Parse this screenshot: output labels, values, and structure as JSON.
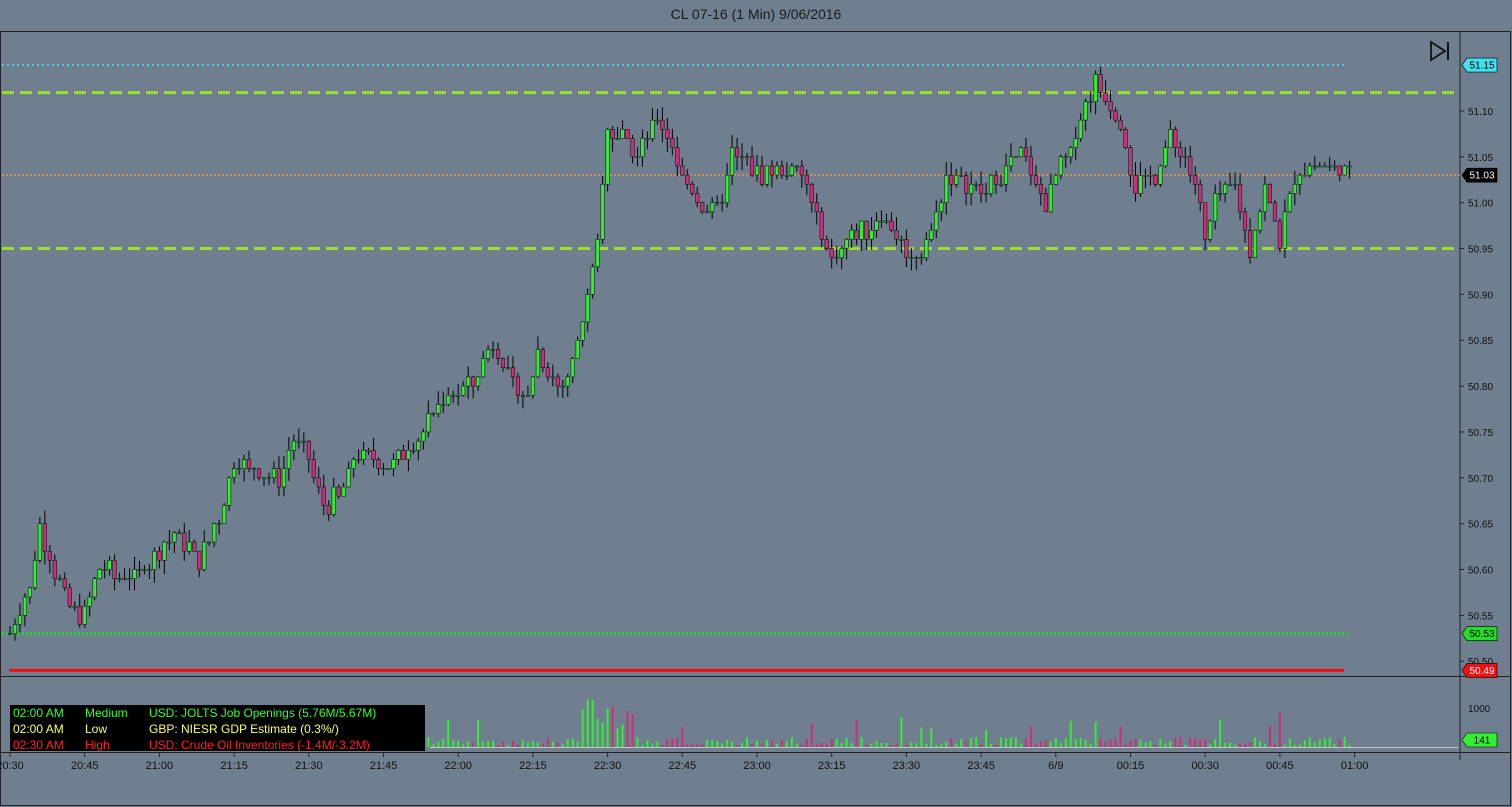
{
  "window": {
    "title": "CL 07-16 (1 Min)  9/06/2016"
  },
  "controls": {
    "play_icon": "skip-forward-icon"
  },
  "colors": {
    "background": "#6f7f90",
    "up_candle": "#33ee33",
    "down_candle": "#cc2f7a",
    "resistance_line": "#9be02a",
    "high_line": "#44e0f0",
    "last_line": "#ff9933",
    "low_line": "#22dd22",
    "red_line": "#ee1111"
  },
  "news_panel": {
    "rows": [
      {
        "time": "02:00 AM",
        "impact": "Medium",
        "event": "USD: JOLTS Job Openings (5.76M/5.67M)",
        "color": "#33ff33"
      },
      {
        "time": "02:00 AM",
        "impact": "Low",
        "event": "GBP: NIESR GDP Estimate (0.3%/)",
        "color": "#ffff66"
      },
      {
        "time": "02:30 AM",
        "impact": "High",
        "event": "USD: Crude Oil Inventories (-1.4M/-3.2M)",
        "color": "#ff2222"
      }
    ]
  },
  "chart_data": {
    "type": "candlestick",
    "title": "CL 07-16 (1 Min)  9/06/2016",
    "ylim": [
      50.485,
      51.185
    ],
    "y_ticks": [
      "51.10",
      "51.05",
      "51.00",
      "50.95",
      "50.90",
      "50.85",
      "50.80",
      "50.75",
      "50.70",
      "50.65",
      "50.60",
      "50.55",
      "50.50"
    ],
    "x_ticks": [
      "20:30",
      "20:45",
      "21:00",
      "21:15",
      "21:30",
      "21:45",
      "22:00",
      "22:15",
      "22:30",
      "22:45",
      "23:00",
      "23:15",
      "23:30",
      "23:45",
      "6/9",
      "00:15",
      "00:30",
      "00:45",
      "01:00"
    ],
    "bar_count": 270,
    "bars_per_tick": 15,
    "price_path": [
      [
        0,
        50.53
      ],
      [
        4,
        50.58
      ],
      [
        6,
        50.65
      ],
      [
        9,
        50.6
      ],
      [
        12,
        50.56
      ],
      [
        15,
        50.55
      ],
      [
        18,
        50.6
      ],
      [
        24,
        50.59
      ],
      [
        30,
        50.62
      ],
      [
        33,
        50.64
      ],
      [
        38,
        50.61
      ],
      [
        42,
        50.66
      ],
      [
        45,
        50.72
      ],
      [
        48,
        50.71
      ],
      [
        54,
        50.7
      ],
      [
        57,
        50.74
      ],
      [
        60,
        50.72
      ],
      [
        63,
        50.67
      ],
      [
        66,
        50.68
      ],
      [
        70,
        50.73
      ],
      [
        75,
        50.71
      ],
      [
        79,
        50.73
      ],
      [
        84,
        50.76
      ],
      [
        88,
        50.79
      ],
      [
        93,
        50.8
      ],
      [
        97,
        50.85
      ],
      [
        100,
        50.81
      ],
      [
        104,
        50.79
      ],
      [
        106,
        50.84
      ],
      [
        110,
        50.8
      ],
      [
        112,
        50.81
      ],
      [
        115,
        50.87
      ],
      [
        118,
        50.95
      ],
      [
        120,
        51.08
      ],
      [
        123,
        51.07
      ],
      [
        126,
        51.05
      ],
      [
        130,
        51.09
      ],
      [
        133,
        51.06
      ],
      [
        135,
        51.03
      ],
      [
        138,
        51.0
      ],
      [
        142,
        50.99
      ],
      [
        145,
        51.05
      ],
      [
        148,
        51.04
      ],
      [
        151,
        51.03
      ],
      [
        156,
        51.04
      ],
      [
        160,
        51.02
      ],
      [
        162,
        50.98
      ],
      [
        165,
        50.94
      ],
      [
        168,
        50.96
      ],
      [
        172,
        50.97
      ],
      [
        175,
        50.99
      ],
      [
        178,
        50.96
      ],
      [
        181,
        50.94
      ],
      [
        183,
        50.95
      ],
      [
        185,
        50.97
      ],
      [
        188,
        51.03
      ],
      [
        192,
        51.02
      ],
      [
        196,
        51.01
      ],
      [
        200,
        51.04
      ],
      [
        203,
        51.05
      ],
      [
        206,
        51.02
      ],
      [
        208,
        51.0
      ],
      [
        211,
        51.04
      ],
      [
        213,
        51.05
      ],
      [
        215,
        51.1
      ],
      [
        218,
        51.13
      ],
      [
        221,
        51.11
      ],
      [
        223,
        51.09
      ],
      [
        226,
        51.02
      ],
      [
        230,
        51.03
      ],
      [
        233,
        51.07
      ],
      [
        236,
        51.05
      ],
      [
        238,
        51.02
      ],
      [
        240,
        50.96
      ],
      [
        242,
        51.0
      ],
      [
        246,
        51.02
      ],
      [
        249,
        50.95
      ],
      [
        252,
        51.02
      ],
      [
        255,
        50.96
      ],
      [
        258,
        51.03
      ],
      [
        262,
        51.04
      ],
      [
        266,
        51.04
      ],
      [
        269,
        51.03
      ]
    ],
    "volume_panel": {
      "ylabel_tick": "1000",
      "last_volume": "141"
    },
    "horizontal_lines": [
      {
        "name": "upper-resistance",
        "price": 51.12,
        "style": "dashed"
      },
      {
        "name": "lower-support",
        "price": 50.95,
        "style": "dashed"
      },
      {
        "name": "session-high",
        "price": 51.15,
        "style": "dotted"
      },
      {
        "name": "last-price",
        "price": 51.03,
        "style": "dotted"
      },
      {
        "name": "session-low",
        "price": 50.53,
        "style": "dotted"
      },
      {
        "name": "red-level",
        "price": 50.49,
        "style": "solid"
      }
    ],
    "price_badges": [
      {
        "label": "51.15",
        "price": 51.15,
        "bg": "#44e0f0",
        "fg": "#000000"
      },
      {
        "label": "51.03",
        "price": 51.03,
        "bg": "#000000",
        "fg": "#ffffff"
      },
      {
        "label": "50.53",
        "price": 50.53,
        "bg": "#22dd22",
        "fg": "#000000"
      },
      {
        "label": "50.49",
        "price": 50.49,
        "bg": "#ee1111",
        "fg": "#ffffff"
      }
    ]
  }
}
